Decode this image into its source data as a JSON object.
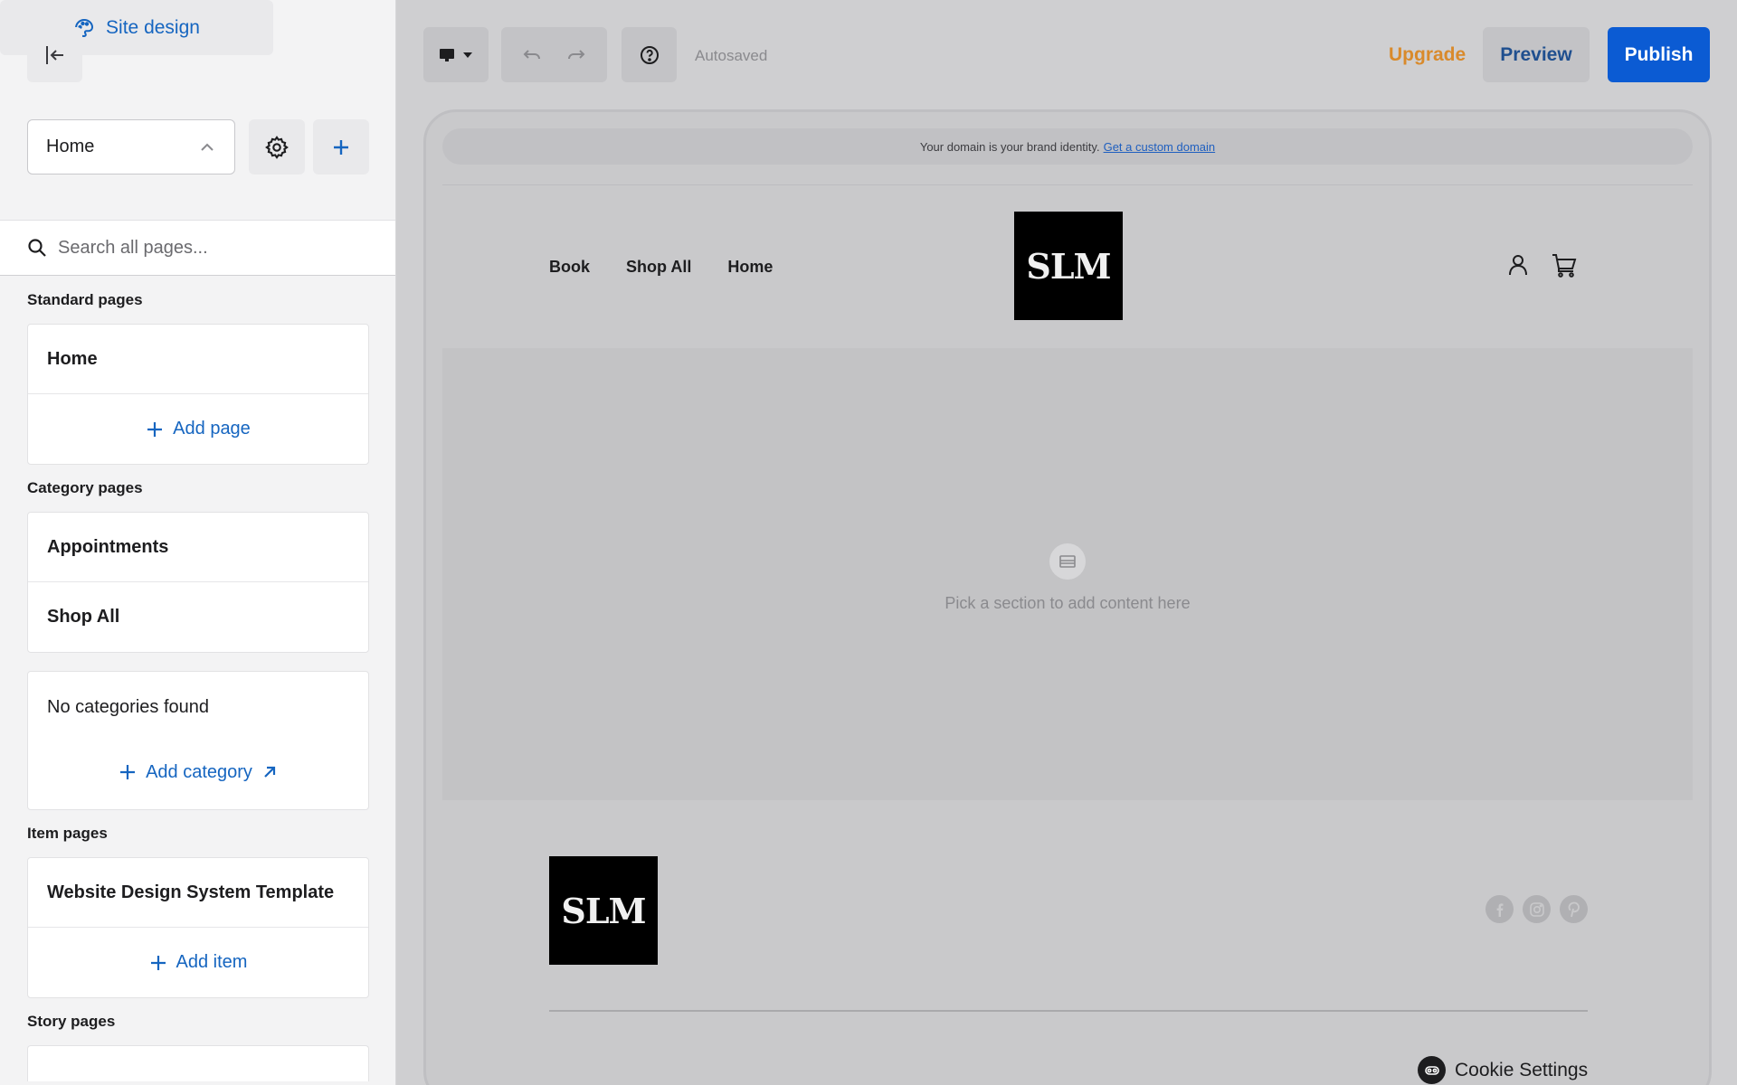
{
  "sidebar": {
    "site_design_label": "Site design",
    "page_select_value": "Home",
    "search_placeholder": "Search all pages...",
    "sections": {
      "standard": {
        "label": "Standard pages",
        "items": [
          "Home"
        ],
        "action": "Add page"
      },
      "category": {
        "label": "Category pages",
        "items": [
          "Appointments",
          "Shop All"
        ],
        "empty_text": "No categories found",
        "action": "Add category"
      },
      "item": {
        "label": "Item pages",
        "items": [
          "Website Design System Template"
        ],
        "action": "Add item"
      },
      "story": {
        "label": "Story pages"
      }
    }
  },
  "toolbar": {
    "autosaved": "Autosaved",
    "upgrade": "Upgrade",
    "preview": "Preview",
    "publish": "Publish"
  },
  "canvas": {
    "domain_notice": "Your domain is your brand identity.",
    "domain_link": "Get a custom domain",
    "nav": [
      "Book",
      "Shop All",
      "Home"
    ],
    "logo_text": "SLM",
    "empty_section_text": "Pick a section to add content here",
    "cookie_settings": "Cookie Settings"
  },
  "colors": {
    "accent": "#1565c0",
    "publish": "#0b5bd3",
    "upgrade": "#d98a2b"
  }
}
